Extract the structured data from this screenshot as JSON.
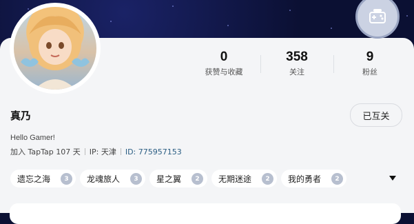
{
  "profile": {
    "name": "真乃",
    "bio": "Hello Gamer!",
    "joined": "加入 TapTap 107 天",
    "ip": "IP: 天津",
    "user_id": "ID: 775957153",
    "follow_status": "已互关"
  },
  "stats": [
    {
      "value": "0",
      "label": "获赞与收藏"
    },
    {
      "value": "358",
      "label": "关注"
    },
    {
      "value": "9",
      "label": "粉丝"
    }
  ],
  "games": [
    {
      "name": "遗忘之海",
      "level": "3"
    },
    {
      "name": "龙魂旅人",
      "level": "3"
    },
    {
      "name": "星之翼",
      "level": "2"
    },
    {
      "name": "无期迷途",
      "level": "2"
    },
    {
      "name": "我的勇者",
      "level": "2"
    }
  ],
  "icons": {
    "badge": "gamepad-badge-icon",
    "expand": "caret-down-icon",
    "level": "level-badge-icon"
  },
  "colors": {
    "banner": "#0b1033",
    "card": "#f4f5f7",
    "id_link": "#2a5d83"
  }
}
